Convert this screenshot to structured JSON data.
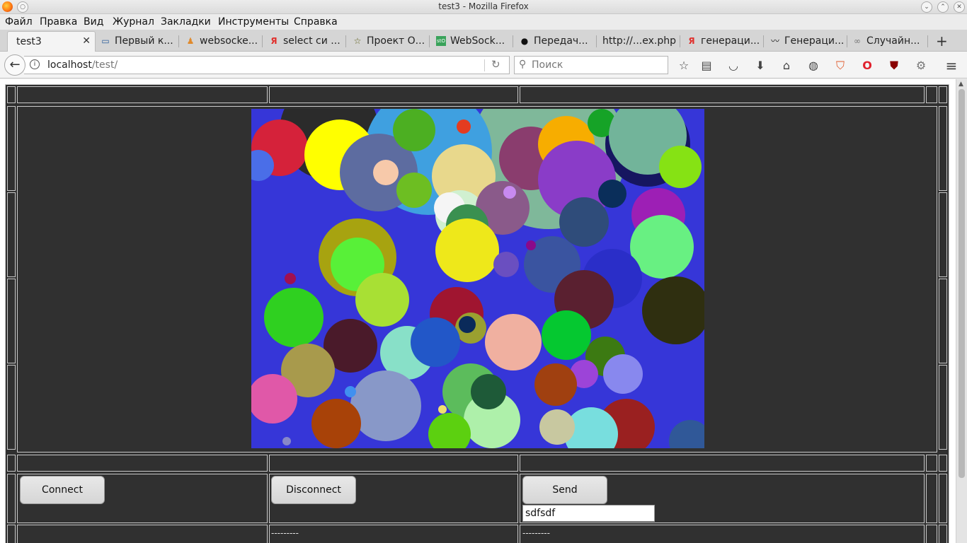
{
  "window": {
    "title": "test3 - Mozilla Firefox"
  },
  "menu": [
    "Файл",
    "Правка",
    "Вид",
    "Журнал",
    "Закладки",
    "Инструменты",
    "Справка"
  ],
  "tabs": [
    {
      "label": "test3",
      "icon": "page-icon",
      "active": true
    },
    {
      "label": "Первый к...",
      "icon": "monitor-icon"
    },
    {
      "label": "websocke...",
      "icon": "person-icon"
    },
    {
      "label": "select си ...",
      "icon": "yandex-icon"
    },
    {
      "label": "Проект О...",
      "icon": "star-icon"
    },
    {
      "label": "WebSock...",
      "icon": "site-icon"
    },
    {
      "label": "Передач...",
      "icon": "github-icon"
    },
    {
      "label": "http://...ex.php",
      "icon": "page-icon"
    },
    {
      "label": "генераци...",
      "icon": "yandex-icon"
    },
    {
      "label": "Генераци...",
      "icon": "wave-icon"
    },
    {
      "label": "Случайн...",
      "icon": "infinity-icon"
    }
  ],
  "nav": {
    "url_host": "localhost",
    "url_path": "/test/",
    "search_placeholder": "Поиск"
  },
  "page": {
    "connect_label": "Connect",
    "disconnect_label": "Disconnect",
    "send_label": "Send",
    "message_value": "sdfsdf",
    "log_col2": "---------",
    "log_col3": "---------"
  },
  "colors": {
    "page_bg": "#303030",
    "canvas_bg": "#3636d8"
  }
}
